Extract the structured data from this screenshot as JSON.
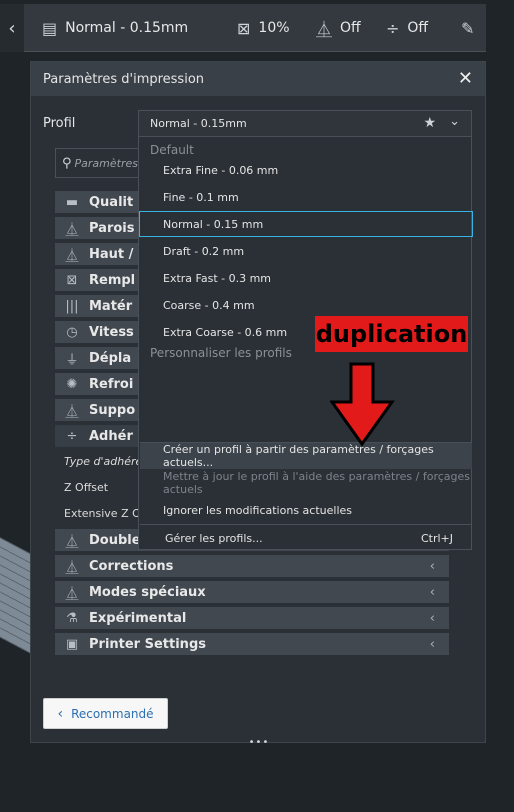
{
  "topbar": {
    "back_icon": "chevron-left-icon",
    "profile": "Normal - 0.15mm",
    "infill": "10%",
    "support": "Off",
    "adhesion": "Off"
  },
  "panel": {
    "title": "Paramètres d'impression",
    "profile_label": "Profil",
    "profile_value": "Normal - 0.15mm",
    "search_placeholder": "Paramètres ...",
    "categories_top": [
      "Qualit",
      "Parois",
      "Haut /",
      "Rempl",
      "Matér",
      "Vitess",
      "Dépla",
      "Refroi",
      "Suppo",
      "Adhér"
    ],
    "settings": {
      "adhesion_type": "Type d'adhérence",
      "z_offset": "Z Offset",
      "extensive_z": "Extensive Z Of"
    },
    "categories_bottom": [
      "Double",
      "Corrections",
      "Modes spéciaux",
      "Expérimental",
      "Printer Settings"
    ],
    "recommended_button": "Recommandé"
  },
  "dropdown": {
    "group_default": "Default",
    "items": [
      "Extra Fine - 0.06 mm",
      "Fine - 0.1 mm",
      "Normal - 0.15 mm",
      "Draft - 0.2 mm",
      "Extra Fast - 0.3 mm",
      "Coarse - 0.4 mm",
      "Extra Coarse - 0.6 mm"
    ],
    "group_custom": "Personnaliser les profils",
    "actions": {
      "create": "Créer un profil à partir des paramètres / forçages actuels...",
      "update": "Mettre à jour le profil à l'aide des paramètres / forçages actuels",
      "discard": "Ignorer les modifications actuelles",
      "manage": "Gérer les profils...",
      "manage_shortcut": "Ctrl+J"
    }
  },
  "annotation": {
    "text": "duplication",
    "color": "#e21a1a"
  },
  "colors": {
    "accent": "#37b3e3",
    "panel": "#2b3036"
  }
}
